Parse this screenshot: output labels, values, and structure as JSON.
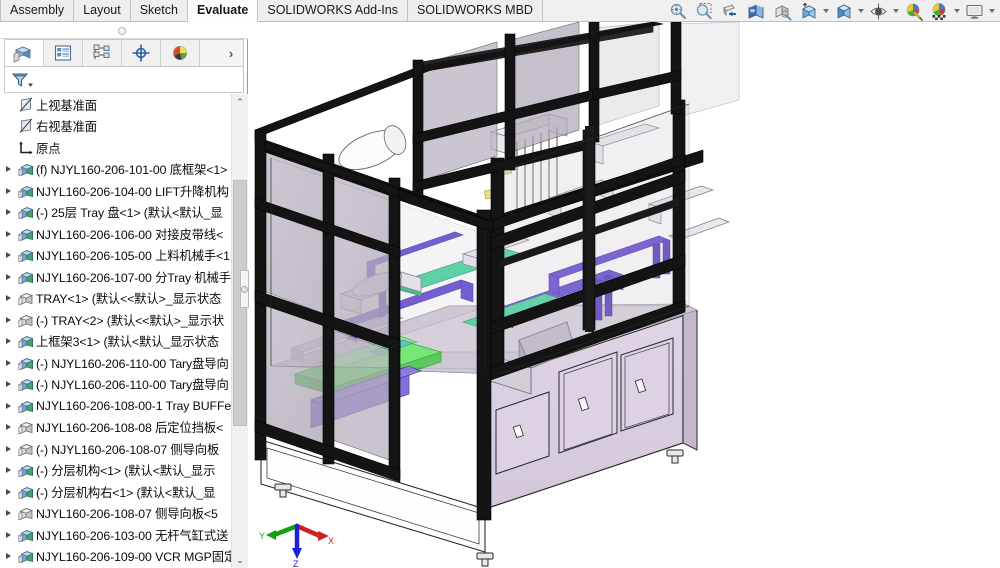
{
  "app": {
    "title": "SOLIDWORKS Assembly",
    "viewport_background": "#ffffff"
  },
  "ribbon": {
    "tabs": [
      {
        "label": "Assembly",
        "active": false
      },
      {
        "label": "Layout",
        "active": false
      },
      {
        "label": "Sketch",
        "active": false
      },
      {
        "label": "Evaluate",
        "active": true
      },
      {
        "label": "SOLIDWORKS Add-Ins",
        "active": false
      },
      {
        "label": "SOLIDWORKS MBD",
        "active": false
      }
    ],
    "tools": [
      {
        "name": "zoom-to-fit-icon",
        "caret": false
      },
      {
        "name": "zoom-to-area-icon",
        "caret": false
      },
      {
        "name": "section-view-icon",
        "caret": false
      },
      {
        "name": "view-orientation-icon",
        "caret": false
      },
      {
        "name": "rotate-view-icon",
        "caret": false
      },
      {
        "name": "display-style-icon",
        "caret": true
      },
      {
        "name": "hide-show-components-icon",
        "caret": true
      },
      {
        "name": "view-settings-icon",
        "caret": true
      },
      {
        "name": "apply-scene-icon",
        "caret": false
      },
      {
        "name": "appearance-icon",
        "caret": true
      },
      {
        "name": "viewport-layout-icon",
        "caret": true
      }
    ]
  },
  "left_panel": {
    "tree_tabs": [
      {
        "name": "feature-manager-design-tree-tab",
        "selected": true
      },
      {
        "name": "property-manager-tab",
        "selected": false
      },
      {
        "name": "configuration-manager-tab",
        "selected": false
      },
      {
        "name": "dimxpert-manager-tab",
        "selected": false
      },
      {
        "name": "display-manager-tab",
        "selected": false
      }
    ],
    "tree_tabs_more_label": "›",
    "filter_icon": "filter-funnel-icon",
    "scroll_up_glyph": "⌃",
    "scroll_down_glyph": "⌄",
    "tree_items": [
      {
        "icon": "plane-icon",
        "expander": false,
        "label": "上视基准面"
      },
      {
        "icon": "plane-icon",
        "expander": false,
        "label": "右视基准面"
      },
      {
        "icon": "origin-icon",
        "expander": false,
        "label": "原点"
      },
      {
        "icon": "assembly-icon",
        "expander": true,
        "label": "(f) NJYL160-206-101-00  底框架<1>"
      },
      {
        "icon": "assembly-icon",
        "expander": true,
        "label": "NJYL160-206-104-00   LIFT升降机构"
      },
      {
        "icon": "assembly-icon",
        "expander": true,
        "label": "(-) 25层 Tray 盘<1> (默认<默认_显"
      },
      {
        "icon": "assembly-icon",
        "expander": true,
        "label": "NJYL160-206-106-00 对接皮带线<"
      },
      {
        "icon": "assembly-icon",
        "expander": true,
        "label": "NJYL160-206-105-00 上料机械手<1"
      },
      {
        "icon": "assembly-icon",
        "expander": true,
        "label": "NJYL160-206-107-00  分Tray 机械手"
      },
      {
        "icon": "part-icon",
        "expander": true,
        "label": "TRAY<1> (默认<<默认>_显示状态"
      },
      {
        "icon": "part-icon",
        "expander": true,
        "label": "(-) TRAY<2> (默认<<默认>_显示状"
      },
      {
        "icon": "assembly-icon",
        "expander": true,
        "label": "上框架3<1> (默认<默认_显示状态"
      },
      {
        "icon": "assembly-icon",
        "expander": true,
        "label": "(-) NJYL160-206-110-00  Tary盘导向"
      },
      {
        "icon": "assembly-icon",
        "expander": true,
        "label": "(-) NJYL160-206-110-00  Tary盘导向"
      },
      {
        "icon": "assembly-icon",
        "expander": true,
        "label": "NJYL160-206-108-00-1  Tray BUFFe"
      },
      {
        "icon": "part-icon",
        "expander": true,
        "label": "NJYL160-206-108-08   后定位挡板<"
      },
      {
        "icon": "part-icon",
        "expander": true,
        "label": "(-) NJYL160-206-108-07   侧导向板"
      },
      {
        "icon": "assembly-icon",
        "expander": true,
        "label": "(-) 分层机构<1> (默认<默认_显示"
      },
      {
        "icon": "assembly-icon",
        "expander": true,
        "label": "(-) 分层机构右<1> (默认<默认_显"
      },
      {
        "icon": "part-icon",
        "expander": true,
        "label": "NJYL160-206-108-07   侧导向板<5"
      },
      {
        "icon": "assembly-icon",
        "expander": true,
        "label": "NJYL160-206-103-00   无杆气缸式送"
      },
      {
        "icon": "assembly-icon",
        "expander": true,
        "label": "NJYL160-206-109-00  VCR MGP固定"
      }
    ]
  },
  "viewport": {
    "triad": {
      "x_axis_label": "X",
      "x_axis_color": "#d02020",
      "y_axis_label": "Y",
      "y_axis_color": "#12a012",
      "z_axis_label": "Z",
      "z_axis_color": "#2020d8"
    },
    "model": {
      "name": "tray-handling-machine-assembly",
      "frame_color": "#141414",
      "panel_color": "#b2aab8",
      "cabinet_color": "#d9cee0",
      "base_color": "#ffffff",
      "green_tray_color": "#5cf05c",
      "purple_rail_color": "#5b3fd1",
      "teal_plate_color": "#3fd39a",
      "gray_machine_color": "#c9c4cf"
    }
  }
}
